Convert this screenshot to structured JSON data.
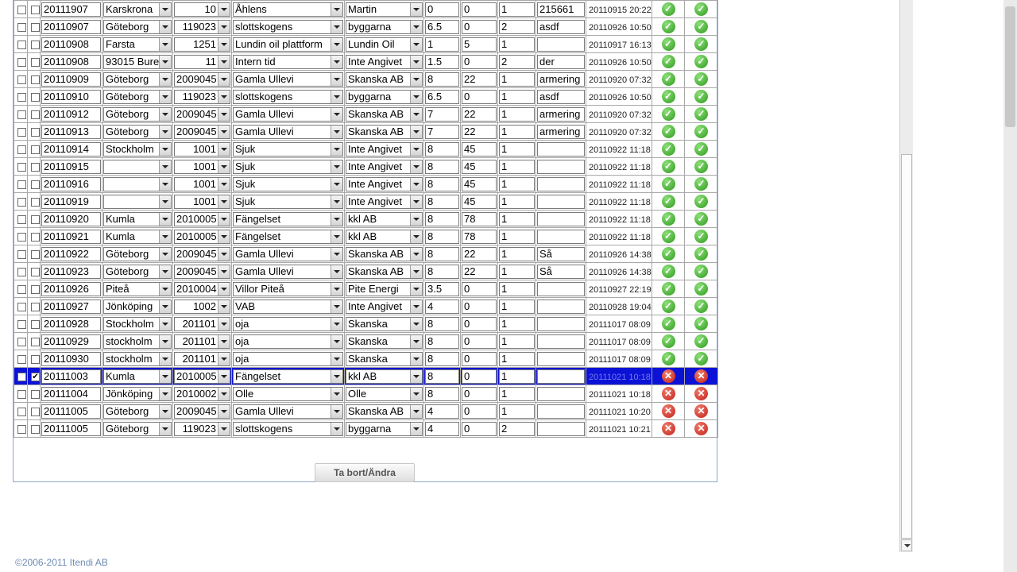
{
  "grid": {
    "rows": [
      {
        "chk1": false,
        "chk2": false,
        "date": "20111907",
        "city": "Karskrona",
        "project": "10",
        "place": "Åhlens",
        "customer": "Martin",
        "hours": "0",
        "km": "0",
        "count": "1",
        "note": "215661",
        "timestamp": "20110915 20:22",
        "status1": "ok",
        "status2": "ok",
        "selected": false
      },
      {
        "chk1": false,
        "chk2": false,
        "date": "20110907",
        "city": "Göteborg",
        "project": "119023",
        "place": "slottskogens",
        "customer": "byggarna",
        "hours": "6.5",
        "km": "0",
        "count": "2",
        "note": "asdf",
        "timestamp": "20110926 10:50",
        "status1": "ok",
        "status2": "ok",
        "selected": false
      },
      {
        "chk1": false,
        "chk2": false,
        "date": "20110908",
        "city": "Farsta",
        "project": "1251",
        "place": "Lundin oil plattform",
        "customer": "Lundin Oil",
        "hours": "1",
        "km": "5",
        "count": "1",
        "note": "",
        "timestamp": "20110917 16:13",
        "status1": "ok",
        "status2": "ok",
        "selected": false
      },
      {
        "chk1": false,
        "chk2": false,
        "date": "20110908",
        "city": "93015 Bure",
        "project": "11",
        "place": "Intern tid",
        "customer": "Inte Angivet",
        "hours": "1.5",
        "km": "0",
        "count": "2",
        "note": "der",
        "timestamp": "20110926 10:50",
        "status1": "ok",
        "status2": "ok",
        "selected": false
      },
      {
        "chk1": false,
        "chk2": false,
        "date": "20110909",
        "city": "Göteborg",
        "project": "2009045",
        "place": "Gamla Ullevi",
        "customer": "Skanska AB",
        "hours": "8",
        "km": "22",
        "count": "1",
        "note": "armering",
        "timestamp": "20110920 07:32",
        "status1": "ok",
        "status2": "ok",
        "selected": false
      },
      {
        "chk1": false,
        "chk2": false,
        "date": "20110910",
        "city": "Göteborg",
        "project": "119023",
        "place": "slottskogens",
        "customer": "byggarna",
        "hours": "6.5",
        "km": "0",
        "count": "1",
        "note": "asdf",
        "timestamp": "20110926 10:50",
        "status1": "ok",
        "status2": "ok",
        "selected": false
      },
      {
        "chk1": false,
        "chk2": false,
        "date": "20110912",
        "city": "Göteborg",
        "project": "2009045",
        "place": "Gamla Ullevi",
        "customer": "Skanska AB",
        "hours": "7",
        "km": "22",
        "count": "1",
        "note": "armering",
        "timestamp": "20110920 07:32",
        "status1": "ok",
        "status2": "ok",
        "selected": false
      },
      {
        "chk1": false,
        "chk2": false,
        "date": "20110913",
        "city": "Göteborg",
        "project": "2009045",
        "place": "Gamla Ullevi",
        "customer": "Skanska AB",
        "hours": "7",
        "km": "22",
        "count": "1",
        "note": "armering",
        "timestamp": "20110920 07:32",
        "status1": "ok",
        "status2": "ok",
        "selected": false
      },
      {
        "chk1": false,
        "chk2": false,
        "date": "20110914",
        "city": "Stockholm",
        "project": "1001",
        "place": "Sjuk",
        "customer": "Inte Angivet",
        "hours": "8",
        "km": "45",
        "count": "1",
        "note": "",
        "timestamp": "20110922 11:18",
        "status1": "ok",
        "status2": "ok",
        "selected": false
      },
      {
        "chk1": false,
        "chk2": false,
        "date": "20110915",
        "city": "",
        "project": "1001",
        "place": "Sjuk",
        "customer": "Inte Angivet",
        "hours": "8",
        "km": "45",
        "count": "1",
        "note": "",
        "timestamp": "20110922 11:18",
        "status1": "ok",
        "status2": "ok",
        "selected": false
      },
      {
        "chk1": false,
        "chk2": false,
        "date": "20110916",
        "city": "",
        "project": "1001",
        "place": "Sjuk",
        "customer": "Inte Angivet",
        "hours": "8",
        "km": "45",
        "count": "1",
        "note": "",
        "timestamp": "20110922 11:18",
        "status1": "ok",
        "status2": "ok",
        "selected": false
      },
      {
        "chk1": false,
        "chk2": false,
        "date": "20110919",
        "city": "",
        "project": "1001",
        "place": "Sjuk",
        "customer": "Inte Angivet",
        "hours": "8",
        "km": "45",
        "count": "1",
        "note": "",
        "timestamp": "20110922 11:18",
        "status1": "ok",
        "status2": "ok",
        "selected": false
      },
      {
        "chk1": false,
        "chk2": false,
        "date": "20110920",
        "city": "Kumla",
        "project": "2010005",
        "place": "Fängelset",
        "customer": "kkl AB",
        "hours": "8",
        "km": "78",
        "count": "1",
        "note": "",
        "timestamp": "20110922 11:18",
        "status1": "ok",
        "status2": "ok",
        "selected": false
      },
      {
        "chk1": false,
        "chk2": false,
        "date": "20110921",
        "city": "Kumla",
        "project": "2010005",
        "place": "Fängelset",
        "customer": "kkl AB",
        "hours": "8",
        "km": "78",
        "count": "1",
        "note": "",
        "timestamp": "20110922 11:18",
        "status1": "ok",
        "status2": "ok",
        "selected": false
      },
      {
        "chk1": false,
        "chk2": false,
        "date": "20110922",
        "city": "Göteborg",
        "project": "2009045",
        "place": "Gamla Ullevi",
        "customer": "Skanska AB",
        "hours": "8",
        "km": "22",
        "count": "1",
        "note": "Så",
        "timestamp": "20110926 14:38",
        "status1": "ok",
        "status2": "ok",
        "selected": false
      },
      {
        "chk1": false,
        "chk2": false,
        "date": "20110923",
        "city": "Göteborg",
        "project": "2009045",
        "place": "Gamla Ullevi",
        "customer": "Skanska AB",
        "hours": "8",
        "km": "22",
        "count": "1",
        "note": "Så",
        "timestamp": "20110926 14:38",
        "status1": "ok",
        "status2": "ok",
        "selected": false
      },
      {
        "chk1": false,
        "chk2": false,
        "date": "20110926",
        "city": "Piteå",
        "project": "2010004",
        "place": "Villor Piteå",
        "customer": "Pite Energi",
        "hours": "3.5",
        "km": "0",
        "count": "1",
        "note": "",
        "timestamp": "20110927 22:19",
        "status1": "ok",
        "status2": "ok",
        "selected": false
      },
      {
        "chk1": false,
        "chk2": false,
        "date": "20110927",
        "city": "Jönköping",
        "project": "1002",
        "place": "VAB",
        "customer": "Inte Angivet",
        "hours": "4",
        "km": "0",
        "count": "1",
        "note": "",
        "timestamp": "20110928 19:04",
        "status1": "ok",
        "status2": "ok",
        "selected": false
      },
      {
        "chk1": false,
        "chk2": false,
        "date": "20110928",
        "city": "Stockholm",
        "project": "201101",
        "place": "oja",
        "customer": "Skanska",
        "hours": "8",
        "km": "0",
        "count": "1",
        "note": "",
        "timestamp": "20111017 08:09",
        "status1": "ok",
        "status2": "ok",
        "selected": false
      },
      {
        "chk1": false,
        "chk2": false,
        "date": "20110929",
        "city": "stockholm",
        "project": "201101",
        "place": "oja",
        "customer": "Skanska",
        "hours": "8",
        "km": "0",
        "count": "1",
        "note": "",
        "timestamp": "20111017 08:09",
        "status1": "ok",
        "status2": "ok",
        "selected": false
      },
      {
        "chk1": false,
        "chk2": false,
        "date": "20110930",
        "city": "stockholm",
        "project": "201101",
        "place": "oja",
        "customer": "Skanska",
        "hours": "8",
        "km": "0",
        "count": "1",
        "note": "",
        "timestamp": "20111017 08:09",
        "status1": "ok",
        "status2": "ok",
        "selected": false
      },
      {
        "chk1": false,
        "chk2": true,
        "date": "20111003",
        "city": "Kumla",
        "project": "2010005",
        "place": "Fängelset",
        "customer": "kkl AB",
        "hours": "8",
        "km": "0",
        "count": "1",
        "note": "",
        "timestamp": "20111021 10:18",
        "status1": "err",
        "status2": "err",
        "selected": true
      },
      {
        "chk1": false,
        "chk2": false,
        "date": "20111004",
        "city": "Jönköping",
        "project": "2010002",
        "place": "Olle",
        "customer": "Olle",
        "hours": "8",
        "km": "0",
        "count": "1",
        "note": "",
        "timestamp": "20111021 10:18",
        "status1": "err",
        "status2": "err",
        "selected": false
      },
      {
        "chk1": false,
        "chk2": false,
        "date": "20111005",
        "city": "Göteborg",
        "project": "2009045",
        "place": "Gamla Ullevi",
        "customer": "Skanska AB",
        "hours": "4",
        "km": "0",
        "count": "1",
        "note": "",
        "timestamp": "20111021 10:20",
        "status1": "err",
        "status2": "err",
        "selected": false
      },
      {
        "chk1": false,
        "chk2": false,
        "date": "20111005",
        "city": "Göteborg",
        "project": "119023",
        "place": "slottskogens",
        "customer": "byggarna",
        "hours": "4",
        "km": "0",
        "count": "2",
        "note": "",
        "timestamp": "20111021 10:21",
        "status1": "err",
        "status2": "err",
        "selected": false
      }
    ]
  },
  "actions": {
    "submit_label": "Ta bort/Ändra"
  },
  "footer": {
    "copyright": "©2006-2011 Itendi AB"
  },
  "icons": {
    "ok": "check-circle-icon",
    "err": "x-circle-icon"
  },
  "colors": {
    "selected_row": "#0b12d6",
    "ok": "#2e9a1d",
    "err": "#c3221a",
    "footer_text": "#6d8cb2"
  }
}
